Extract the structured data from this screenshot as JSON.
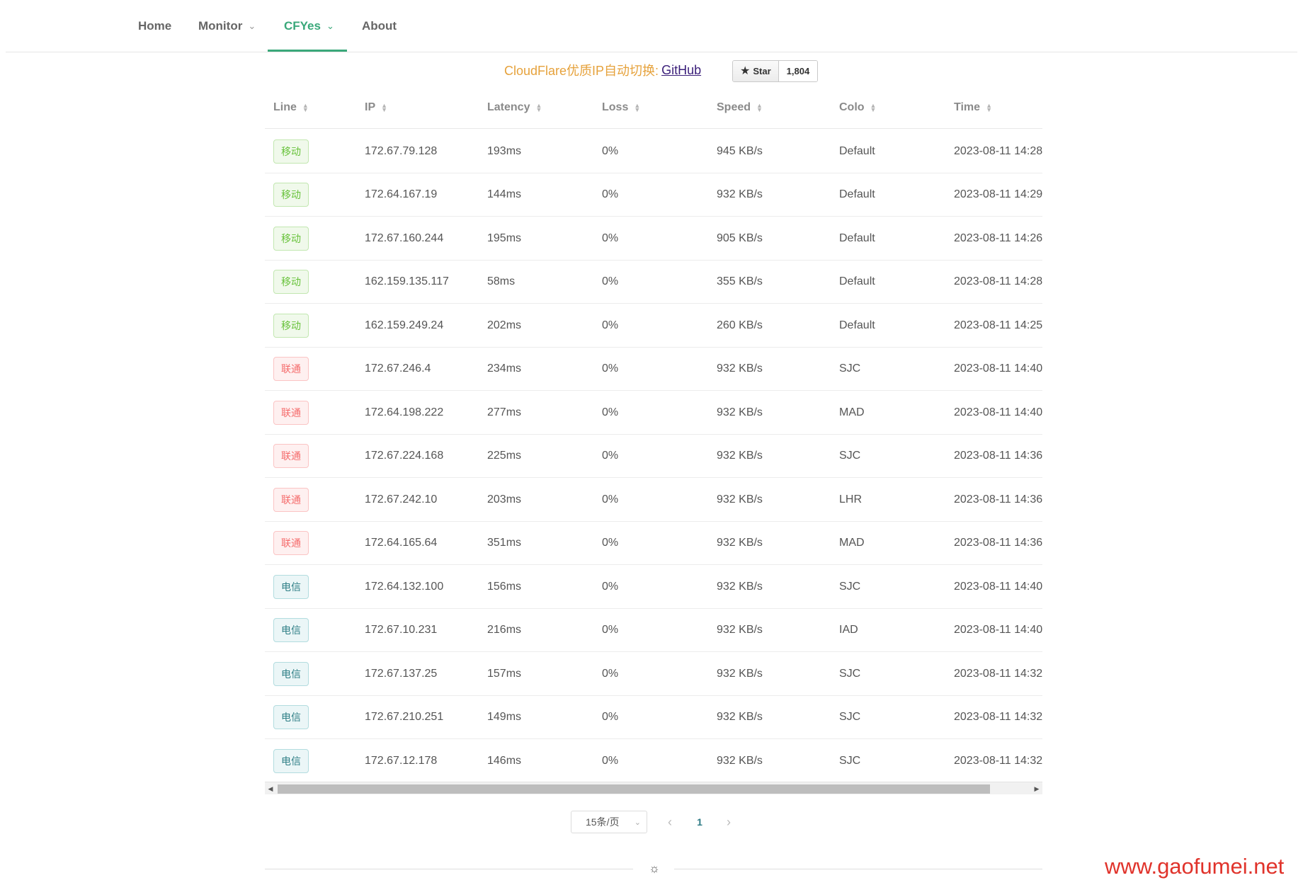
{
  "nav": {
    "items": [
      {
        "label": "Home",
        "has_dropdown": false,
        "active": false
      },
      {
        "label": "Monitor",
        "has_dropdown": true,
        "active": false
      },
      {
        "label": "CFYes",
        "has_dropdown": true,
        "active": true
      },
      {
        "label": "About",
        "has_dropdown": false,
        "active": false
      }
    ],
    "accent_color": "#3aa87a"
  },
  "promo": {
    "text": "CloudFlare优质IP自动切换:",
    "link_label": "GitHub",
    "star_label": "Star",
    "star_count": "1,804"
  },
  "table": {
    "columns": [
      "Line",
      "IP",
      "Latency",
      "Loss",
      "Speed",
      "Colo",
      "Time"
    ],
    "rows": [
      {
        "line": "移动",
        "type": "mobile",
        "ip": "172.67.79.128",
        "latency": "193ms",
        "loss": "0%",
        "speed": "945 KB/s",
        "colo": "Default",
        "time": "2023-08-11 14:28:"
      },
      {
        "line": "移动",
        "type": "mobile",
        "ip": "172.64.167.19",
        "latency": "144ms",
        "loss": "0%",
        "speed": "932 KB/s",
        "colo": "Default",
        "time": "2023-08-11 14:29:"
      },
      {
        "line": "移动",
        "type": "mobile",
        "ip": "172.67.160.244",
        "latency": "195ms",
        "loss": "0%",
        "speed": "905 KB/s",
        "colo": "Default",
        "time": "2023-08-11 14:26:"
      },
      {
        "line": "移动",
        "type": "mobile",
        "ip": "162.159.135.117",
        "latency": "58ms",
        "loss": "0%",
        "speed": "355 KB/s",
        "colo": "Default",
        "time": "2023-08-11 14:28:"
      },
      {
        "line": "移动",
        "type": "mobile",
        "ip": "162.159.249.24",
        "latency": "202ms",
        "loss": "0%",
        "speed": "260 KB/s",
        "colo": "Default",
        "time": "2023-08-11 14:25:"
      },
      {
        "line": "联通",
        "type": "unicom",
        "ip": "172.67.246.4",
        "latency": "234ms",
        "loss": "0%",
        "speed": "932 KB/s",
        "colo": "SJC",
        "time": "2023-08-11 14:40:"
      },
      {
        "line": "联通",
        "type": "unicom",
        "ip": "172.64.198.222",
        "latency": "277ms",
        "loss": "0%",
        "speed": "932 KB/s",
        "colo": "MAD",
        "time": "2023-08-11 14:40:"
      },
      {
        "line": "联通",
        "type": "unicom",
        "ip": "172.67.224.168",
        "latency": "225ms",
        "loss": "0%",
        "speed": "932 KB/s",
        "colo": "SJC",
        "time": "2023-08-11 14:36:"
      },
      {
        "line": "联通",
        "type": "unicom",
        "ip": "172.67.242.10",
        "latency": "203ms",
        "loss": "0%",
        "speed": "932 KB/s",
        "colo": "LHR",
        "time": "2023-08-11 14:36:"
      },
      {
        "line": "联通",
        "type": "unicom",
        "ip": "172.64.165.64",
        "latency": "351ms",
        "loss": "0%",
        "speed": "932 KB/s",
        "colo": "MAD",
        "time": "2023-08-11 14:36:"
      },
      {
        "line": "电信",
        "type": "telecom",
        "ip": "172.64.132.100",
        "latency": "156ms",
        "loss": "0%",
        "speed": "932 KB/s",
        "colo": "SJC",
        "time": "2023-08-11 14:40:"
      },
      {
        "line": "电信",
        "type": "telecom",
        "ip": "172.67.10.231",
        "latency": "216ms",
        "loss": "0%",
        "speed": "932 KB/s",
        "colo": "IAD",
        "time": "2023-08-11 14:40:"
      },
      {
        "line": "电信",
        "type": "telecom",
        "ip": "172.67.137.25",
        "latency": "157ms",
        "loss": "0%",
        "speed": "932 KB/s",
        "colo": "SJC",
        "time": "2023-08-11 14:32:"
      },
      {
        "line": "电信",
        "type": "telecom",
        "ip": "172.67.210.251",
        "latency": "149ms",
        "loss": "0%",
        "speed": "932 KB/s",
        "colo": "SJC",
        "time": "2023-08-11 14:32:"
      },
      {
        "line": "电信",
        "type": "telecom",
        "ip": "172.67.12.178",
        "latency": "146ms",
        "loss": "0%",
        "speed": "932 KB/s",
        "colo": "SJC",
        "time": "2023-08-11 14:32:"
      }
    ]
  },
  "pagination": {
    "page_size_label": "15条/页",
    "current_page": "1"
  },
  "watermark": "www.gaofumei.net"
}
